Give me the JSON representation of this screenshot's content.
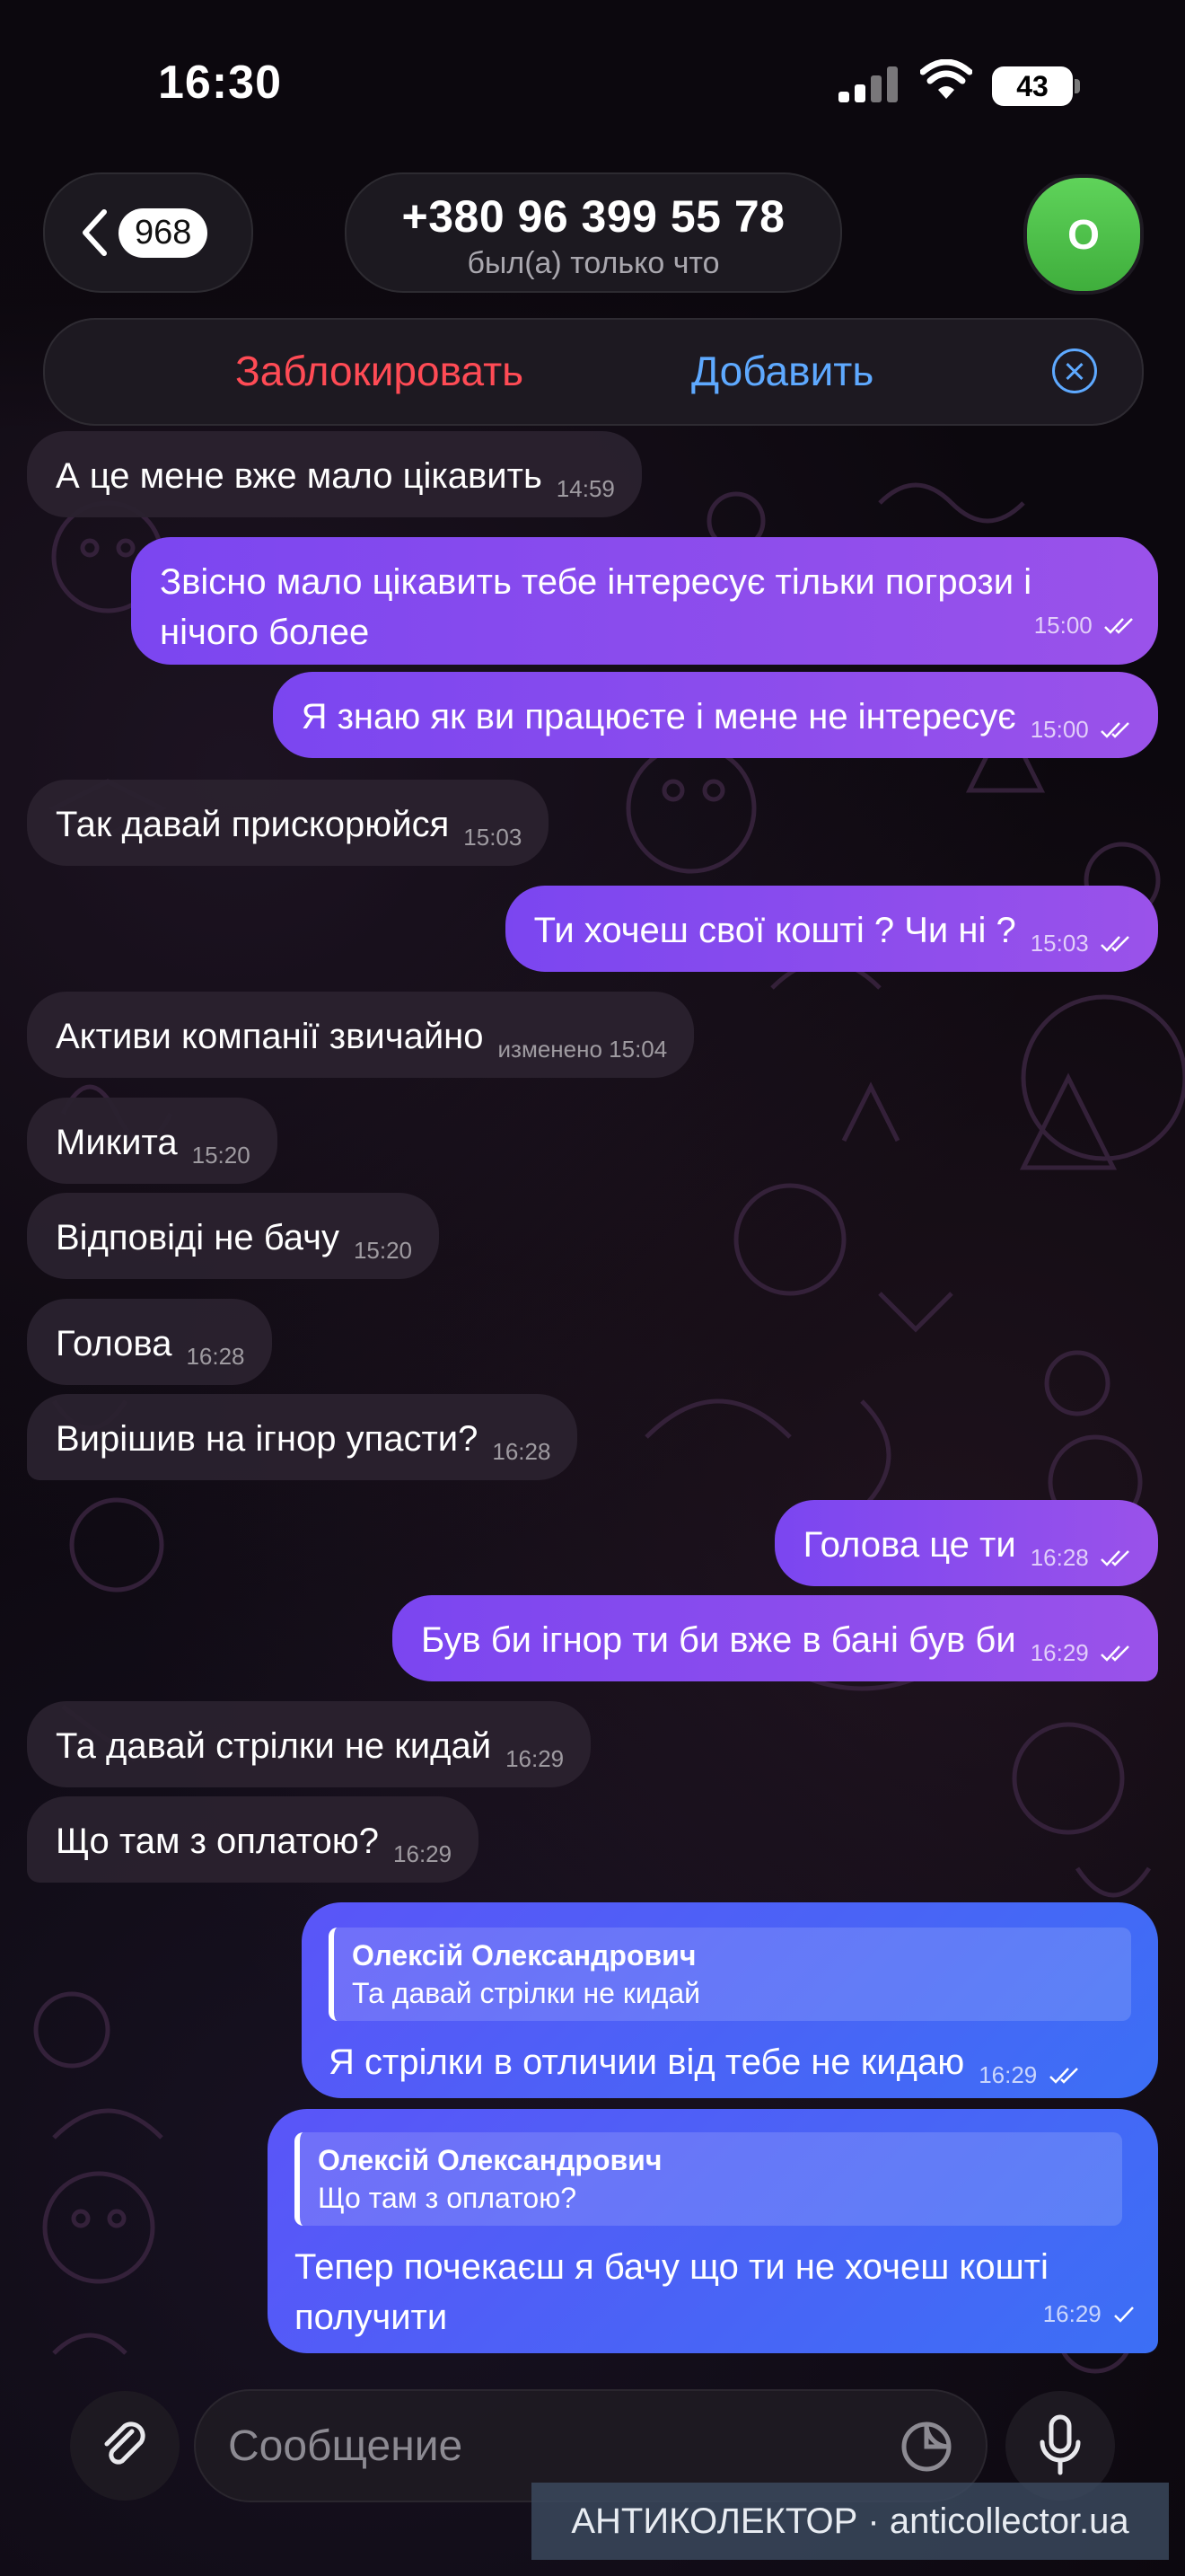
{
  "status_bar": {
    "time": "16:30",
    "battery": "43"
  },
  "header": {
    "unread_count": "968",
    "title": "+380 96 399 55 78",
    "subtitle": "был(а) только что",
    "avatar_letter": "О"
  },
  "action_bar": {
    "block_label": "Заблокировать",
    "add_label": "Добавить"
  },
  "messages": [
    {
      "dir": "in",
      "text": "А це мене вже мало цікавить",
      "time": "14:59"
    },
    {
      "dir": "out",
      "text": "Звісно мало цікавить тебе інтересує тільки погрози і нічого более",
      "time": "15:00"
    },
    {
      "dir": "out",
      "text": "Я знаю як ви працюєте і мене не інтересує",
      "time": "15:00"
    },
    {
      "dir": "in",
      "text": "Так давай прискорюйся",
      "time": "15:03"
    },
    {
      "dir": "out",
      "text": "Ти хочеш свої кошті ? Чи ні ?",
      "time": "15:03"
    },
    {
      "dir": "in",
      "text": "Активи компанії звичайно",
      "time": "изменено 15:04"
    },
    {
      "dir": "in",
      "text": "Микита",
      "time": "15:20"
    },
    {
      "dir": "in",
      "text": "Відповіді не бачу",
      "time": "15:20"
    },
    {
      "dir": "in",
      "text": "Голова",
      "time": "16:28"
    },
    {
      "dir": "in",
      "text": "Вирішив на ігнор упасти?",
      "time": "16:28"
    },
    {
      "dir": "out",
      "text": "Голова це ти",
      "time": "16:28"
    },
    {
      "dir": "out",
      "text": "Був би ігнор ти би вже в бані був би",
      "time": "16:29"
    },
    {
      "dir": "in",
      "text": "Та давай стрілки не кидай",
      "time": "16:29"
    },
    {
      "dir": "in",
      "text": "Що там з оплатою?",
      "time": "16:29"
    },
    {
      "dir": "out",
      "text": "Я стрілки в отличии від тебе не кидаю",
      "time": "16:29",
      "reply_name": "Олексій Олександрович",
      "reply_text": "Та давай стрілки не кидай"
    },
    {
      "dir": "out",
      "text": "Тепер почекаєш я бачу що ти не хочеш кошті получити",
      "time": "16:29",
      "reply_name": "Олексій Олександрович",
      "reply_text": "Що там з оплатою?"
    }
  ],
  "composer": {
    "placeholder": "Сообщение"
  },
  "watermark": "АНТИКОЛЕКТОР · anticollector.ua",
  "colors": {
    "outgoing": "#8a4cee",
    "outgoing_reply": "#4a66f6",
    "incoming": "#2a222e",
    "block": "#ff4b55",
    "accent": "#5ea9ff",
    "avatar": "#4fc44a"
  },
  "icons": [
    "chevron-left-icon",
    "signal-icon",
    "wifi-icon",
    "battery-icon",
    "close-circle-icon",
    "paperclip-icon",
    "sticker-icon",
    "microphone-icon",
    "double-check-icon"
  ]
}
